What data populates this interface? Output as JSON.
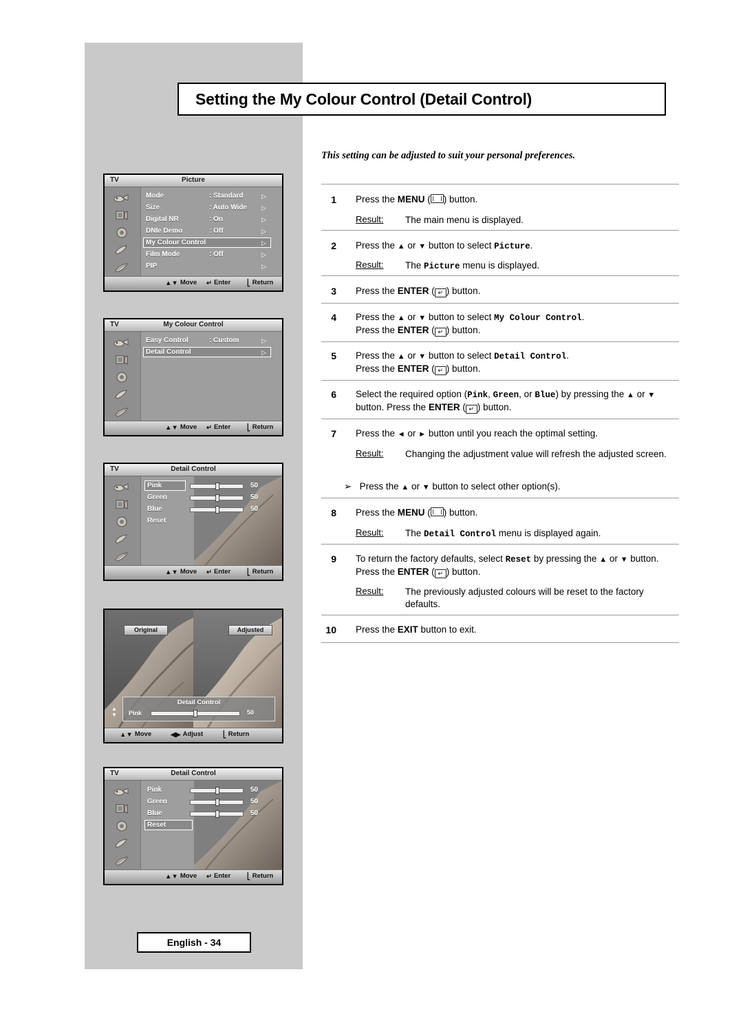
{
  "page": {
    "title": "Setting the My Colour Control (Detail Control)",
    "intro": "This setting can be adjusted to suit your personal preferences.",
    "footer": "English - 34"
  },
  "osd_footer": {
    "move": "Move",
    "enter": "Enter",
    "return": "Return",
    "adjust": "Adjust"
  },
  "osd_panels": [
    {
      "tv_label": "TV",
      "title": "Picture",
      "rows": [
        {
          "label": "Mode",
          "value": ": Standard",
          "arrow": "▷",
          "selected": false
        },
        {
          "label": "Size",
          "value": ": Auto Wide",
          "arrow": "▷",
          "selected": false
        },
        {
          "label": "Digital NR",
          "value": ": On",
          "arrow": "▷",
          "selected": false
        },
        {
          "label": "DNIe Demo",
          "value": ": Off",
          "arrow": "▷",
          "selected": false
        },
        {
          "label": "My Colour Control",
          "value": "",
          "arrow": "▷",
          "selected": true
        },
        {
          "label": "Film Mode",
          "value": ": Off",
          "arrow": "▷",
          "selected": false
        },
        {
          "label": "PIP",
          "value": "",
          "arrow": "▷",
          "selected": false
        }
      ]
    },
    {
      "tv_label": "TV",
      "title": "My Colour Control",
      "rows": [
        {
          "label": "Easy Control",
          "value": ": Custom",
          "arrow": "▷",
          "selected": false
        },
        {
          "label": "Detail Control",
          "value": "",
          "arrow": "▷",
          "selected": true
        }
      ]
    },
    {
      "tv_label": "TV",
      "title": "Detail Control",
      "sliders": [
        {
          "label": "Pink",
          "value": "50",
          "percent": 50,
          "selected": true
        },
        {
          "label": "Green",
          "value": "50",
          "percent": 50,
          "selected": false
        },
        {
          "label": "Blue",
          "value": "50",
          "percent": 50,
          "selected": false
        }
      ],
      "reset": {
        "label": "Reset",
        "selected": false
      }
    },
    {
      "tv_label": "TV",
      "title": "Detail Control",
      "sliders": [
        {
          "label": "Pink",
          "value": "50",
          "percent": 50,
          "selected": false
        },
        {
          "label": "Green",
          "value": "50",
          "percent": 50,
          "selected": false
        },
        {
          "label": "Blue",
          "value": "50",
          "percent": 50,
          "selected": false
        }
      ],
      "reset": {
        "label": "Reset",
        "selected": true
      }
    }
  ],
  "photo_panel": {
    "left_tag": "Original",
    "right_tag": "Adjusted",
    "osd_title": "Detail Control",
    "slider": {
      "label": "Pink",
      "value": "50",
      "percent": 50
    }
  },
  "steps": [
    {
      "num": "1",
      "text_html": "Press the <b class=\"bld\">MENU</b> (<span class=\"key-menu\"></span>) button.",
      "result_label": "Result:",
      "result_html": "The main menu is displayed."
    },
    {
      "num": "2",
      "text_html": "Press the <span class=\"tri\">▲</span> or <span class=\"tri\">▼</span> button to select <span class=\"mono\">Picture</span>.",
      "result_label": "Result:",
      "result_html": "The <span class=\"mono\">Picture</span> menu is displayed."
    },
    {
      "num": "3",
      "text_html": "Press the <b class=\"bld\">ENTER</b> (<span class=\"key-enter\">↵</span>) button.",
      "result_label": "",
      "result_html": ""
    },
    {
      "num": "4",
      "text_html": "Press the <span class=\"tri\">▲</span> or <span class=\"tri\">▼</span> button to select <span class=\"mono\">My Colour Control</span>.<br>Press the <b class=\"bld\">ENTER</b> (<span class=\"key-enter\">↵</span>) button.",
      "result_label": "",
      "result_html": ""
    },
    {
      "num": "5",
      "text_html": "Press the <span class=\"tri\">▲</span> or <span class=\"tri\">▼</span> button to select <span class=\"mono\">Detail Control</span>.<br>Press the <b class=\"bld\">ENTER</b> (<span class=\"key-enter\">↵</span>) button.",
      "result_label": "",
      "result_html": ""
    },
    {
      "num": "6",
      "text_html": "Select the required option (<span class=\"mono\">Pink</span>, <span class=\"mono\">Green</span>, or <span class=\"mono\">Blue</span>) by pressing the <span class=\"tri\">▲</span> or <span class=\"tri\">▼</span> button. Press the <b class=\"bld\">ENTER</b> (<span class=\"key-enter\">↵</span>) button.",
      "result_label": "",
      "result_html": ""
    },
    {
      "num": "7",
      "text_html": "Press the <span class=\"tri\">◄</span> or <span class=\"tri\">►</span> button until you reach the optimal setting.",
      "result_label": "Result:",
      "result_html": "Changing the adjustment value will refresh the adjusted screen.",
      "note_html": "➢&nbsp;&nbsp; Press the <span class=\"tri\">▲</span> or <span class=\"tri\">▼</span> button to select other option(s)."
    },
    {
      "num": "8",
      "text_html": "Press the <b class=\"bld\">MENU</b> (<span class=\"key-menu\"></span>) button.",
      "result_label": "Result:",
      "result_html": "The <span class=\"mono\">Detail Control</span> menu is displayed again."
    },
    {
      "num": "9",
      "text_html": "To return the factory defaults, select <span class=\"mono\">Reset</span> by pressing the <span class=\"tri\">▲</span> or <span class=\"tri\">▼</span> button. Press the <b class=\"bld\">ENTER</b> (<span class=\"key-enter\">↵</span>) button.",
      "result_label": "Result:",
      "result_html": "The previously adjusted colours will be reset to the factory defaults."
    },
    {
      "num": "10",
      "text_html": "Press the <b class=\"bld\">EXIT</b> button to exit.",
      "result_label": "",
      "result_html": ""
    }
  ]
}
